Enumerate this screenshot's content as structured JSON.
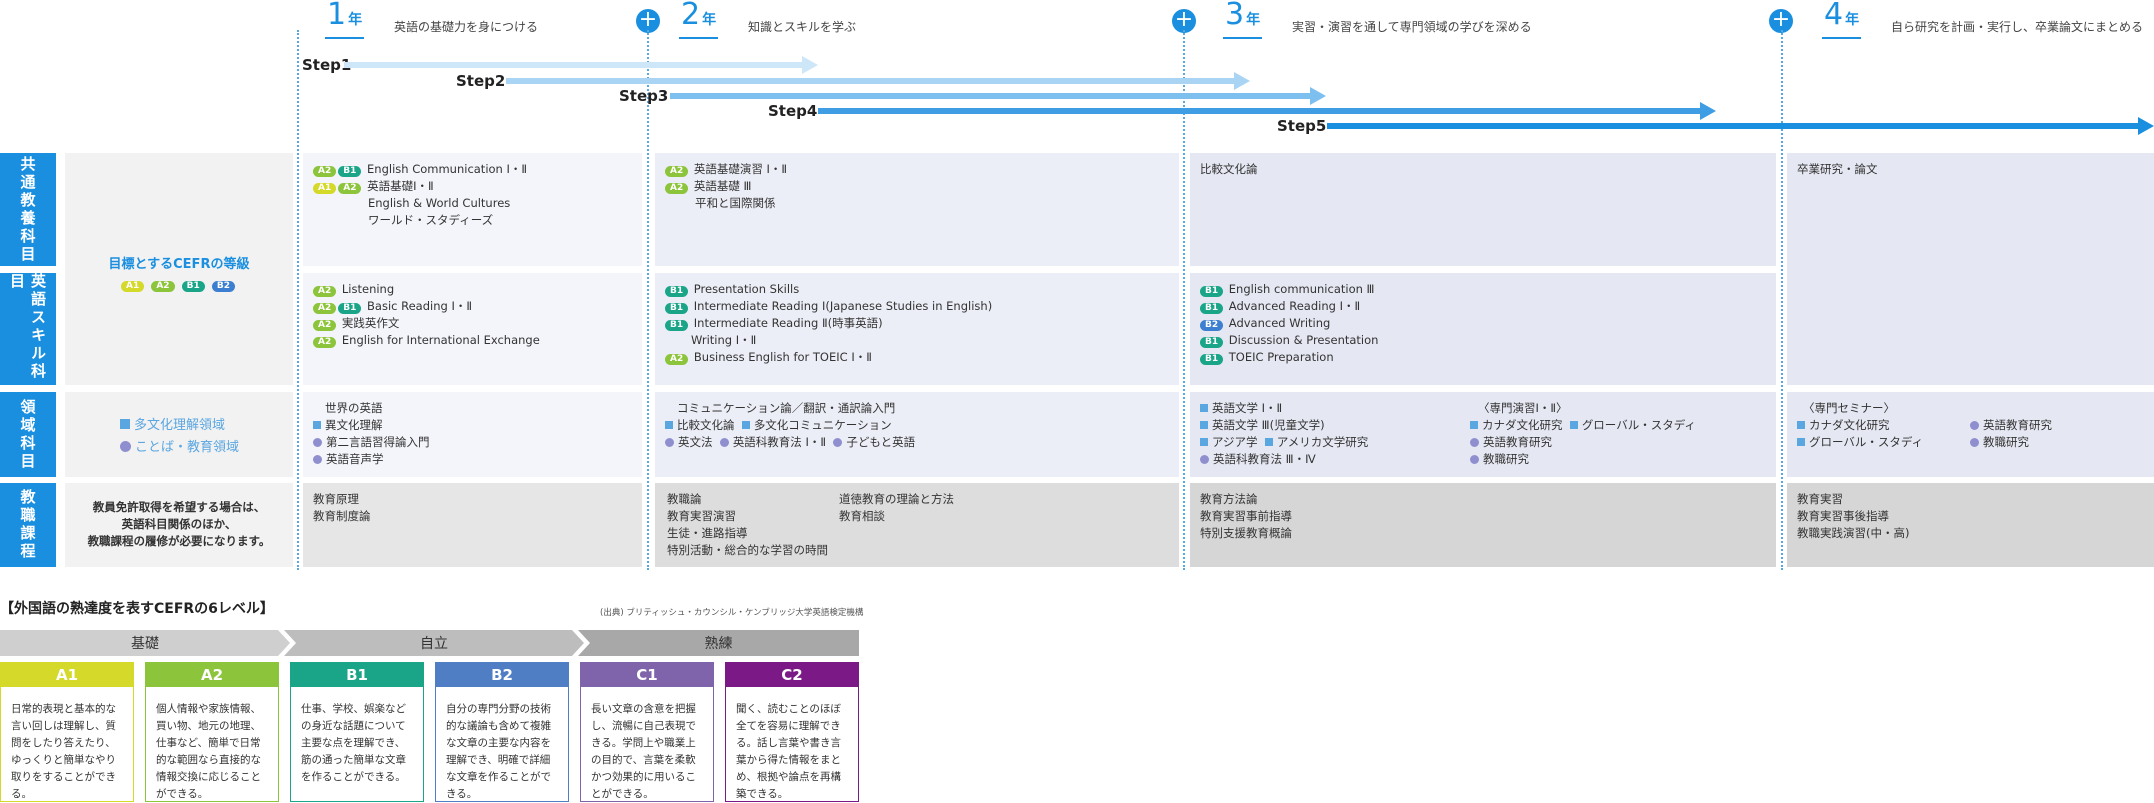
{
  "years": [
    {
      "num": "1",
      "unit": "年",
      "desc": "英語の基礎力を身につける"
    },
    {
      "num": "2",
      "unit": "年",
      "desc": "知識とスキルを学ぶ"
    },
    {
      "num": "3",
      "unit": "年",
      "desc": "実習・演習を通して専門領域の学びを深める"
    },
    {
      "num": "4",
      "unit": "年",
      "desc": "自ら研究を計画・実行し、卒業論文にまとめる"
    }
  ],
  "plus_symbol": "+",
  "steps": [
    "Step1",
    "Step2",
    "Step3",
    "Step4",
    "Step5"
  ],
  "colors": {
    "accent": "#1a8fe0",
    "step1": "#cde6f8",
    "step2": "#a9d4f3",
    "step3": "#7dbfee",
    "step4": "#3e9de3",
    "step5": "#1a8fe0"
  },
  "categories": [
    "共通教養科目",
    "英語スキル科目",
    "領域科目",
    "教職課程"
  ],
  "left": {
    "cefr_title": "目標とするCEFRの等級",
    "cefr_badges": [
      "A1",
      "A2",
      "B1",
      "B2"
    ],
    "domain1": "多文化理解領域",
    "domain2": "ことば・教育領域",
    "kyoshoku_note": [
      "教員免許取得を希望する場合は、",
      "英語科目関係のほか、",
      "教職課程の履修が必要になります。"
    ]
  },
  "common": {
    "y1": [
      {
        "badges": [
          "A2",
          "B1"
        ],
        "text": "English Communication Ⅰ・Ⅱ"
      },
      {
        "badges": [
          "A1",
          "A2"
        ],
        "text": "英語基礎Ⅰ・Ⅱ"
      },
      {
        "badges": [],
        "text": "English & World Cultures"
      },
      {
        "badges": [],
        "text": "ワールド・スタディーズ"
      }
    ],
    "y2": [
      {
        "badges": [
          "A2"
        ],
        "text": "英語基礎演習 Ⅰ・Ⅱ"
      },
      {
        "badges": [
          "A2"
        ],
        "text": "英語基礎 Ⅲ"
      },
      {
        "badges": [],
        "text": "平和と国際関係"
      }
    ],
    "y3": [
      {
        "badges": [],
        "text": "比較文化論"
      }
    ],
    "y4": [
      {
        "badges": [],
        "text": "卒業研究・論文"
      }
    ]
  },
  "skills": {
    "y1": [
      {
        "badges": [
          "A2"
        ],
        "text": "Listening"
      },
      {
        "badges": [
          "A2",
          "B1"
        ],
        "text": "Basic Reading Ⅰ・Ⅱ"
      },
      {
        "badges": [
          "A2"
        ],
        "text": "実践英作文"
      },
      {
        "badges": [
          "A2"
        ],
        "text": "English for International Exchange"
      }
    ],
    "y2": [
      {
        "badges": [
          "B1"
        ],
        "text": "Presentation Skills"
      },
      {
        "badges": [
          "B1"
        ],
        "text": "Intermediate Reading Ⅰ(Japanese Studies in English)"
      },
      {
        "badges": [
          "B1"
        ],
        "text": "Intermediate Reading Ⅱ(時事英語)"
      },
      {
        "badges": [],
        "text": "Writing Ⅰ・Ⅱ"
      },
      {
        "badges": [
          "A2"
        ],
        "text": "Business English for TOEIC Ⅰ・Ⅱ"
      }
    ],
    "y3": [
      {
        "badges": [
          "B1"
        ],
        "text": "English communication Ⅲ"
      },
      {
        "badges": [
          "B1"
        ],
        "text": "Advanced Reading Ⅰ・Ⅱ"
      },
      {
        "badges": [
          "B2"
        ],
        "text": "Advanced Writing"
      },
      {
        "badges": [
          "B1"
        ],
        "text": "Discussion & Presentation"
      },
      {
        "badges": [
          "B1"
        ],
        "text": "TOEIC Preparation"
      }
    ]
  },
  "domain": {
    "y1": {
      "head": "世界の英語",
      "items": [
        {
          "m": "sq",
          "t": "異文化理解"
        },
        {
          "m": "dot",
          "t": "第二言語習得論入門"
        },
        {
          "m": "dot",
          "t": "英語音声学"
        }
      ]
    },
    "y2": {
      "head": "コミュニケーション論／翻訳・通訳論入門",
      "r1": [
        {
          "m": "sq",
          "t": "比較文化論"
        },
        {
          "m": "sq",
          "t": "多文化コミュニケーション"
        }
      ],
      "r2": [
        {
          "m": "dot",
          "t": "英文法"
        },
        {
          "m": "dot",
          "t": "英語科教育法 Ⅰ・Ⅱ"
        },
        {
          "m": "dot",
          "t": "子どもと英語"
        }
      ]
    },
    "y3": {
      "left": [
        {
          "m": "sq",
          "t": "英語文学 Ⅰ・Ⅱ"
        },
        {
          "m": "sq",
          "t": "英語文学 Ⅲ(児童文学)"
        },
        {
          "m": "sq",
          "t": "アジア学"
        },
        {
          "m": "dot",
          "t": "英語科教育法 Ⅲ・Ⅳ"
        }
      ],
      "left_extra": {
        "m": "sq",
        "t": "アメリカ文学研究"
      },
      "right_head": "〈専門演習Ⅰ・Ⅱ〉",
      "right": [
        {
          "m": "sq",
          "t": "カナダ文化研究"
        },
        {
          "m": "dot",
          "t": "英語教育研究"
        },
        {
          "m": "dot",
          "t": "教職研究"
        }
      ],
      "right_extra": {
        "m": "sq",
        "t": "グローバル・スタディ"
      }
    },
    "y4": {
      "head": "〈専門セミナー〉",
      "left": [
        {
          "m": "sq",
          "t": "カナダ文化研究"
        },
        {
          "m": "sq",
          "t": "グローバル・スタディ"
        }
      ],
      "right": [
        {
          "m": "dot",
          "t": "英語教育研究"
        },
        {
          "m": "dot",
          "t": "教職研究"
        }
      ]
    }
  },
  "teaching": {
    "y1": [
      "教育原理",
      "教育制度論"
    ],
    "y2_left": [
      "教職論",
      "教育実習演習",
      "生徒・進路指導",
      "特別活動・総合的な学習の時間"
    ],
    "y2_right": [
      "道徳教育の理論と方法",
      "教育相談"
    ],
    "y3": [
      "教育方法論",
      "教育実習事前指導",
      "特別支援教育概論"
    ],
    "y4": [
      "教育実習",
      "教育実習事後指導",
      "教職実践演習(中・高)"
    ]
  },
  "cefr": {
    "title": "【外国語の熟達度を表すCEFRの6レベル】",
    "source": "(出典) ブリティッシュ・カウンシル・ケンブリッジ大学英語検定機構",
    "groups": [
      "基礎",
      "自立",
      "熟練"
    ],
    "levels": [
      {
        "name": "A1",
        "color": "#d4d92a",
        "desc": "日常的表現と基本的な言い回しは理解し、質問をしたり答えたり、ゆっくりと簡単なやり取りをすることができる。"
      },
      {
        "name": "A2",
        "color": "#8cc43c",
        "desc": "個人情報や家族情報、買い物、地元の地理、仕事など、簡単で日常的な範囲なら直接的な情報交換に応じることができる。"
      },
      {
        "name": "B1",
        "color": "#1aa589",
        "desc": "仕事、学校、娯楽などの身近な話題について主要な点を理解でき、筋の通った簡単な文章を作ることができる。"
      },
      {
        "name": "B2",
        "color": "#4f7ec4",
        "desc": "自分の専門分野の技術的な議論も含めて複雑な文章の主要な内容を理解でき、明確で詳細な文章を作ることができる。"
      },
      {
        "name": "C1",
        "color": "#7f64ac",
        "desc": "長い文章の含意を把握し、流暢に自己表現できる。学問上や職業上の目的で、言葉を柔軟かつ効果的に用いることができる。"
      },
      {
        "name": "C2",
        "color": "#7b1a86",
        "desc": "聞く、読むことのほぼ全てを容易に理解できる。話し言葉や書き言葉から得た情報をまとめ、根拠や論点を再構築できる。"
      }
    ]
  }
}
